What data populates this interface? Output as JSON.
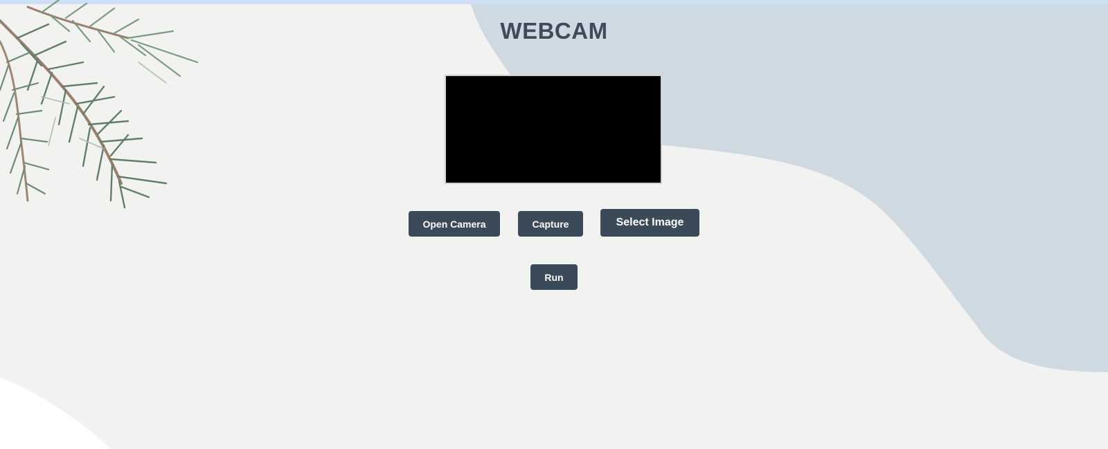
{
  "page": {
    "title": "WEBCAM"
  },
  "video": {
    "state": "black"
  },
  "buttons": {
    "open_camera": "Open Camera",
    "capture": "Capture",
    "select_image": "Select Image",
    "run": "Run"
  },
  "colors": {
    "page_background": "#f2f2f0",
    "blob": "#cfd9e2",
    "button": "#3b4a59",
    "button_text": "#ffffff",
    "title": "#3d4b5a",
    "top_strip": "#cfdff6"
  }
}
